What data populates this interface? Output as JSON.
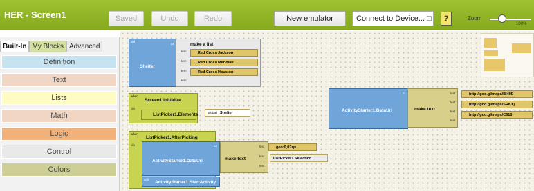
{
  "toolbar": {
    "title": "HER - Screen1",
    "saved_label": "Saved",
    "undo_label": "Undo",
    "redo_label": "Redo",
    "new_emulator_label": "New emulator",
    "connect_label": "Connect to Device... □",
    "help_label": "?",
    "zoom_label": "Zoom",
    "zoom_value": "100%",
    "zoom_level": 0.3
  },
  "sidebar": {
    "tabs": [
      "Built-In",
      "My Blocks",
      "Advanced"
    ],
    "categories": [
      {
        "label": "Definition",
        "color": "#c7e3ef"
      },
      {
        "label": "Text",
        "color": "#f0d6c5"
      },
      {
        "label": "Lists",
        "color": "#fefcc2"
      },
      {
        "label": "Math",
        "color": "#f1d6c4"
      },
      {
        "label": "Logic",
        "color": "#f0b27a"
      },
      {
        "label": "Control",
        "color": "#e9e9e9"
      },
      {
        "label": "Colors",
        "color": "#cdcf97"
      }
    ]
  },
  "canvas": {
    "def_shelter": {
      "tag": "def",
      "name": "Shelter",
      "as_label": "as",
      "make_list": "make a list",
      "item_label": "item",
      "items": [
        "Red Cross Jackson",
        "Red Cross Meridian",
        "Red Cross Houston"
      ],
      "text_tag": "text"
    },
    "initialize": {
      "tag": "when",
      "event": "Screen1.Initialize",
      "do_label": "do",
      "setter": "ListPicker1.Elements",
      "to_label": "to",
      "global_tag": "global",
      "value": "Shelter"
    },
    "after_picking": {
      "tag": "when",
      "event": "ListPicker1.AfterPicking",
      "do_label": "do",
      "setter": "ActivityStarter1.DataUri",
      "to_label": "to",
      "make_text": "make text",
      "text_label": "text",
      "geo": "geo:0,0?q=",
      "selection": "ListPicker1.Selection",
      "call_tag": "call",
      "call": "ActivityStarter1.StartActivity"
    },
    "uri_block": {
      "setter": "ActivityStarter1.DataUri",
      "to_label": "to",
      "make_text": "make text",
      "text_label": "text",
      "urls": [
        "http://goo.gl/maps/Bi49E",
        "http://goo.gl/maps/SRKXj",
        "http://goo.gl/maps/C618"
      ]
    }
  }
}
